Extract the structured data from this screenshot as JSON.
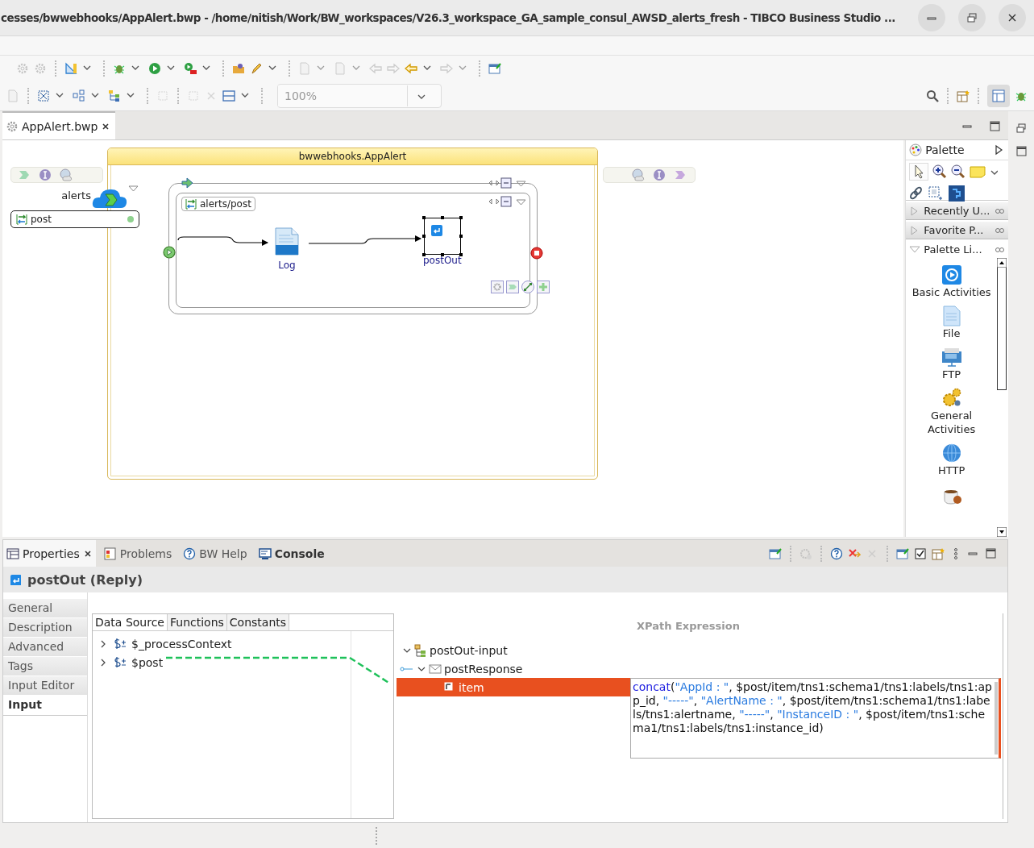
{
  "window": {
    "title": "cesses/bwwebhooks/AppAlert.bwp - /home/nitish/Work/BW_workspaces/V26.3_workspace_GA_sample_consul_AWSD_alerts_fresh - TIBCO Business Studio ..."
  },
  "toolbar": {
    "zoom_value": "100%"
  },
  "editor": {
    "tabs": [
      {
        "label": "AppAlert.bwp",
        "selected": true
      }
    ],
    "process": {
      "title": "bwwebhooks.AppAlert",
      "service": {
        "name": "alerts",
        "operation": "post"
      },
      "scope_label": "alerts/post",
      "activities": [
        {
          "label": "Log",
          "kind": "log",
          "selected": false
        },
        {
          "label": "postOut",
          "kind": "reply",
          "selected": true
        }
      ]
    }
  },
  "palette": {
    "title": "Palette",
    "drawers": [
      {
        "label": "Recently U...",
        "expanded": false
      },
      {
        "label": "Favorite P...",
        "expanded": false
      },
      {
        "label": "Palette Li...",
        "expanded": true
      }
    ],
    "items": [
      {
        "label": "Basic Activities",
        "kind": "basic"
      },
      {
        "label": "File",
        "kind": "file"
      },
      {
        "label": "FTP",
        "kind": "ftp"
      },
      {
        "label": "General Activities",
        "kind": "general"
      },
      {
        "label": "HTTP",
        "kind": "http"
      },
      {
        "kind": "java"
      }
    ]
  },
  "properties": {
    "tabs": [
      {
        "label": "Properties",
        "selected": true,
        "emphasized": false
      },
      {
        "label": "Problems",
        "selected": false,
        "emphasized": false
      },
      {
        "label": "BW Help",
        "selected": false,
        "emphasized": false
      },
      {
        "label": "Console",
        "selected": false,
        "emphasized": true
      }
    ],
    "title": "postOut (Reply)",
    "sections": [
      {
        "label": "General",
        "selected": false
      },
      {
        "label": "Description",
        "selected": false
      },
      {
        "label": "Advanced",
        "selected": false
      },
      {
        "label": "Tags",
        "selected": false
      },
      {
        "label": "Input Editor",
        "selected": false
      },
      {
        "label": "Input",
        "selected": true
      }
    ],
    "mapper": {
      "source_tabs": [
        {
          "label": "Data Source",
          "selected": true
        },
        {
          "label": "Functions",
          "selected": false
        },
        {
          "label": "Constants",
          "selected": false
        }
      ],
      "source_tree": [
        {
          "label": "$_processContext",
          "expanded": false
        },
        {
          "label": "$post",
          "expanded": false
        }
      ],
      "column_header": "XPath Expression",
      "target_tree": [
        {
          "label": "postOut-input",
          "expanded": true,
          "selected": false,
          "children": [
            {
              "label": "postResponse",
              "expanded": true,
              "selected": false,
              "children": [
                {
                  "label": "item",
                  "selected": true
                }
              ]
            }
          ]
        }
      ],
      "expression": [
        {
          "kind": "function",
          "text": "concat"
        },
        {
          "kind": "text",
          "text": "("
        },
        {
          "kind": "string",
          "text": "\"AppId : \""
        },
        {
          "kind": "text",
          "text": ", $post/item/tns1:schema1/tns1:labels/tns1:app_id, "
        },
        {
          "kind": "string",
          "text": "\"-----\""
        },
        {
          "kind": "text",
          "text": ", "
        },
        {
          "kind": "string",
          "text": "\"AlertName : \""
        },
        {
          "kind": "text",
          "text": ", $post/item/tns1:schema1/tns1:labels/tns1:alertname, "
        },
        {
          "kind": "string",
          "text": "\"-----\""
        },
        {
          "kind": "text",
          "text": ", "
        },
        {
          "kind": "string",
          "text": "\"InstanceID : \""
        },
        {
          "kind": "text",
          "text": ", $post/item/tns1:schema1/tns1:labels/tns1:instance_id)"
        }
      ]
    }
  }
}
